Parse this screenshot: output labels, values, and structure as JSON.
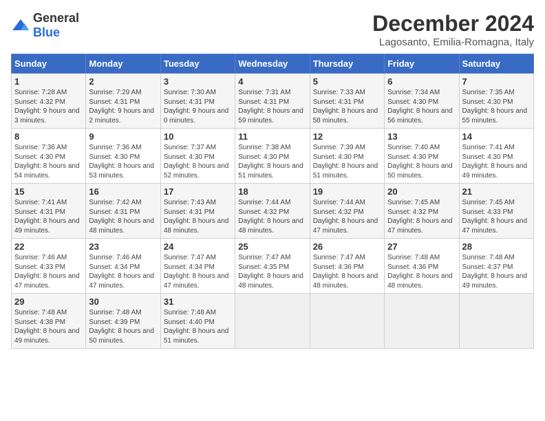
{
  "logo": {
    "general": "General",
    "blue": "Blue"
  },
  "title": "December 2024",
  "location": "Lagosanto, Emilia-Romagna, Italy",
  "days_of_week": [
    "Sunday",
    "Monday",
    "Tuesday",
    "Wednesday",
    "Thursday",
    "Friday",
    "Saturday"
  ],
  "weeks": [
    [
      {
        "day": "1",
        "sunrise": "7:28 AM",
        "sunset": "4:32 PM",
        "daylight": "9 hours and 3 minutes."
      },
      {
        "day": "2",
        "sunrise": "7:29 AM",
        "sunset": "4:31 PM",
        "daylight": "9 hours and 2 minutes."
      },
      {
        "day": "3",
        "sunrise": "7:30 AM",
        "sunset": "4:31 PM",
        "daylight": "9 hours and 0 minutes."
      },
      {
        "day": "4",
        "sunrise": "7:31 AM",
        "sunset": "4:31 PM",
        "daylight": "8 hours and 59 minutes."
      },
      {
        "day": "5",
        "sunrise": "7:33 AM",
        "sunset": "4:31 PM",
        "daylight": "8 hours and 58 minutes."
      },
      {
        "day": "6",
        "sunrise": "7:34 AM",
        "sunset": "4:30 PM",
        "daylight": "8 hours and 56 minutes."
      },
      {
        "day": "7",
        "sunrise": "7:35 AM",
        "sunset": "4:30 PM",
        "daylight": "8 hours and 55 minutes."
      }
    ],
    [
      {
        "day": "8",
        "sunrise": "7:36 AM",
        "sunset": "4:30 PM",
        "daylight": "8 hours and 54 minutes."
      },
      {
        "day": "9",
        "sunrise": "7:36 AM",
        "sunset": "4:30 PM",
        "daylight": "8 hours and 53 minutes."
      },
      {
        "day": "10",
        "sunrise": "7:37 AM",
        "sunset": "4:30 PM",
        "daylight": "8 hours and 52 minutes."
      },
      {
        "day": "11",
        "sunrise": "7:38 AM",
        "sunset": "4:30 PM",
        "daylight": "8 hours and 51 minutes."
      },
      {
        "day": "12",
        "sunrise": "7:39 AM",
        "sunset": "4:30 PM",
        "daylight": "8 hours and 51 minutes."
      },
      {
        "day": "13",
        "sunrise": "7:40 AM",
        "sunset": "4:30 PM",
        "daylight": "8 hours and 50 minutes."
      },
      {
        "day": "14",
        "sunrise": "7:41 AM",
        "sunset": "4:30 PM",
        "daylight": "8 hours and 49 minutes."
      }
    ],
    [
      {
        "day": "15",
        "sunrise": "7:41 AM",
        "sunset": "4:31 PM",
        "daylight": "8 hours and 49 minutes."
      },
      {
        "day": "16",
        "sunrise": "7:42 AM",
        "sunset": "4:31 PM",
        "daylight": "8 hours and 48 minutes."
      },
      {
        "day": "17",
        "sunrise": "7:43 AM",
        "sunset": "4:31 PM",
        "daylight": "8 hours and 48 minutes."
      },
      {
        "day": "18",
        "sunrise": "7:44 AM",
        "sunset": "4:32 PM",
        "daylight": "8 hours and 48 minutes."
      },
      {
        "day": "19",
        "sunrise": "7:44 AM",
        "sunset": "4:32 PM",
        "daylight": "8 hours and 47 minutes."
      },
      {
        "day": "20",
        "sunrise": "7:45 AM",
        "sunset": "4:32 PM",
        "daylight": "8 hours and 47 minutes."
      },
      {
        "day": "21",
        "sunrise": "7:45 AM",
        "sunset": "4:33 PM",
        "daylight": "8 hours and 47 minutes."
      }
    ],
    [
      {
        "day": "22",
        "sunrise": "7:46 AM",
        "sunset": "4:33 PM",
        "daylight": "8 hours and 47 minutes."
      },
      {
        "day": "23",
        "sunrise": "7:46 AM",
        "sunset": "4:34 PM",
        "daylight": "8 hours and 47 minutes."
      },
      {
        "day": "24",
        "sunrise": "7:47 AM",
        "sunset": "4:34 PM",
        "daylight": "8 hours and 47 minutes."
      },
      {
        "day": "25",
        "sunrise": "7:47 AM",
        "sunset": "4:35 PM",
        "daylight": "8 hours and 48 minutes."
      },
      {
        "day": "26",
        "sunrise": "7:47 AM",
        "sunset": "4:36 PM",
        "daylight": "8 hours and 48 minutes."
      },
      {
        "day": "27",
        "sunrise": "7:48 AM",
        "sunset": "4:36 PM",
        "daylight": "8 hours and 48 minutes."
      },
      {
        "day": "28",
        "sunrise": "7:48 AM",
        "sunset": "4:37 PM",
        "daylight": "8 hours and 49 minutes."
      }
    ],
    [
      {
        "day": "29",
        "sunrise": "7:48 AM",
        "sunset": "4:38 PM",
        "daylight": "8 hours and 49 minutes."
      },
      {
        "day": "30",
        "sunrise": "7:48 AM",
        "sunset": "4:39 PM",
        "daylight": "8 hours and 50 minutes."
      },
      {
        "day": "31",
        "sunrise": "7:48 AM",
        "sunset": "4:40 PM",
        "daylight": "8 hours and 51 minutes."
      },
      null,
      null,
      null,
      null
    ]
  ],
  "labels": {
    "sunrise": "Sunrise:",
    "sunset": "Sunset:",
    "daylight": "Daylight:"
  }
}
